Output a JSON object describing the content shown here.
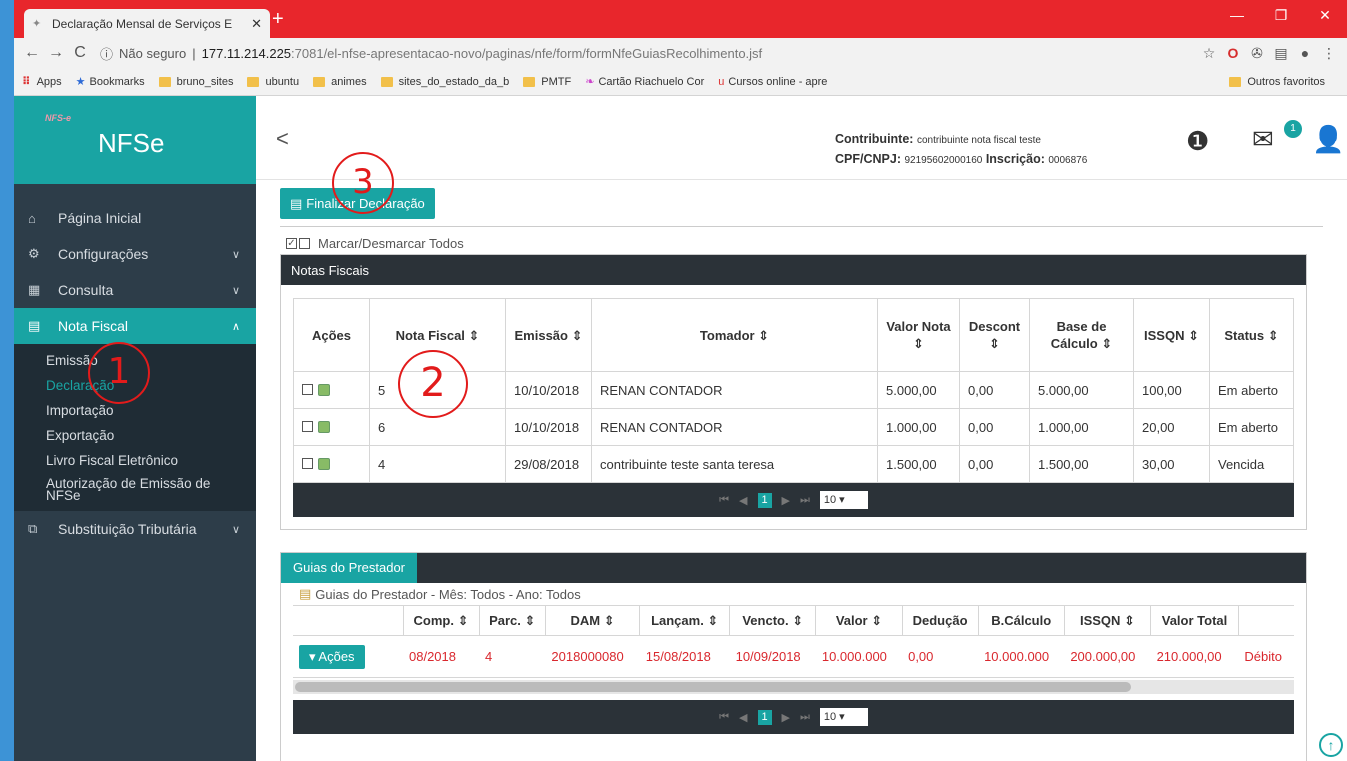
{
  "browser": {
    "tab_title": "Declaração Mensal de Serviços E",
    "url_secure": "Não seguro",
    "url_host": "177.11.214.225",
    "url_path": ":7081/el-nfse-apresentacao-novo/paginas/nfe/form/formNfeGuiasRecolhimento.jsf",
    "bookmarks": [
      "Apps",
      "Bookmarks",
      "bruno_sites",
      "ubuntu",
      "animes",
      "sites_do_estado_da_b",
      "PMTF",
      "Cartão Riachuelo Cor",
      "Cursos online - apre"
    ],
    "other_bookmarks": "Outros favoritos"
  },
  "sidebar": {
    "logo_small": "NFS-e",
    "logo_title": "NFSe",
    "items": [
      {
        "label": "Página Inicial"
      },
      {
        "label": "Configurações"
      },
      {
        "label": "Consulta"
      },
      {
        "label": "Nota Fiscal"
      }
    ],
    "sub_items": [
      "Emissão",
      "Declaração",
      "Importação",
      "Exportação",
      "Livro Fiscal Eletrônico",
      "Autorização de Emissão de NFSe"
    ],
    "last_item": "Substituição Tributária"
  },
  "header": {
    "contrib_label": "Contribuinte:",
    "contrib_value": "contribuinte nota fiscal teste",
    "cpf_label": "CPF/CNPJ:",
    "cpf_value": "92195602000160",
    "insc_label": "Inscrição:",
    "insc_value": "0006876",
    "mail_badge": "1"
  },
  "main": {
    "finalizar": "Finalizar Declaração",
    "marcar": "Marcar/Desmarcar Todos",
    "notas_title": "Notas Fiscais",
    "notas_headers": [
      "Ações",
      "Nota Fiscal ⇕",
      "Emissão ⇕",
      "Tomador ⇕",
      "Valor Nota ⇕",
      "Descont ⇕",
      "Base de Cálculo ⇕",
      "ISSQN ⇕",
      "Status ⇕"
    ],
    "notas_rows": [
      [
        "5",
        "10/10/2018",
        "RENAN CONTADOR",
        "5.000,00",
        "0,00",
        "5.000,00",
        "100,00",
        "Em aberto"
      ],
      [
        "6",
        "10/10/2018",
        "RENAN CONTADOR",
        "1.000,00",
        "0,00",
        "1.000,00",
        "20,00",
        "Em aberto"
      ],
      [
        "4",
        "29/08/2018",
        "contribuinte teste santa teresa",
        "1.500,00",
        "0,00",
        "1.500,00",
        "30,00",
        "Vencida"
      ]
    ],
    "pager_page": "1",
    "pager_size": "10 ▾",
    "guias_title": "Guias do Prestador",
    "guias_caption": "Guias do Prestador - Mês: Todos - Ano: Todos",
    "guias_headers": [
      "",
      "Comp. ⇕",
      "Parc. ⇕",
      "DAM ⇕",
      "Lançam. ⇕",
      "Vencto. ⇕",
      "Valor ⇕",
      "Dedução",
      "B.Cálculo",
      "ISSQN ⇕",
      "Valor Total",
      ""
    ],
    "guias_row": [
      "08/2018",
      "4",
      "2018000080",
      "15/08/2018",
      "10/09/2018",
      "10.000.000",
      "0,00",
      "10.000.000",
      "200.000,00",
      "210.000,00",
      "Débito"
    ],
    "acoes_btn": "▾ Ações"
  },
  "annotations": [
    "1",
    "2",
    "3"
  ],
  "colors": {
    "teal": "#19a4a3",
    "sidebar": "#2d3d49",
    "chrome_red": "#e8262c"
  }
}
